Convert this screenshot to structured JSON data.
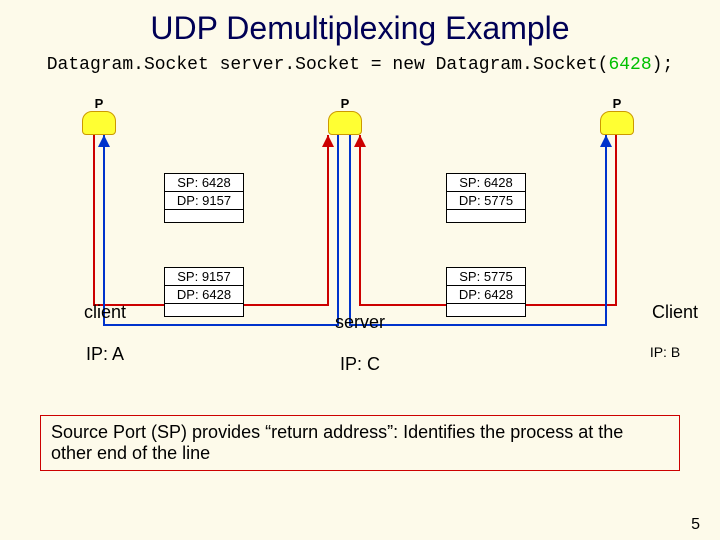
{
  "title": "UDP Demultiplexing Example",
  "code": {
    "pre": "Datagram.Socket server.Socket = new Datagram.Socket(",
    "arg": "6428",
    "post": ");"
  },
  "proc_label": "P",
  "packets": {
    "upL": {
      "sp": "SP: 6428",
      "dp": "DP: 9157"
    },
    "upR": {
      "sp": "SP: 6428",
      "dp": "DP: 5775"
    },
    "dnL": {
      "sp": "SP: 9157",
      "dp": "DP: 6428"
    },
    "dnR": {
      "sp": "SP: 5775",
      "dp": "DP: 6428"
    }
  },
  "hosts": {
    "left": {
      "name": "client",
      "ip": "IP: A"
    },
    "center": {
      "name": "server",
      "ip": "IP: C"
    },
    "right": {
      "name": "Client",
      "ip": "IP: B"
    }
  },
  "footnote": "Source Port (SP) provides “return address”: Identifies the process at the other end of the line",
  "page": "5"
}
